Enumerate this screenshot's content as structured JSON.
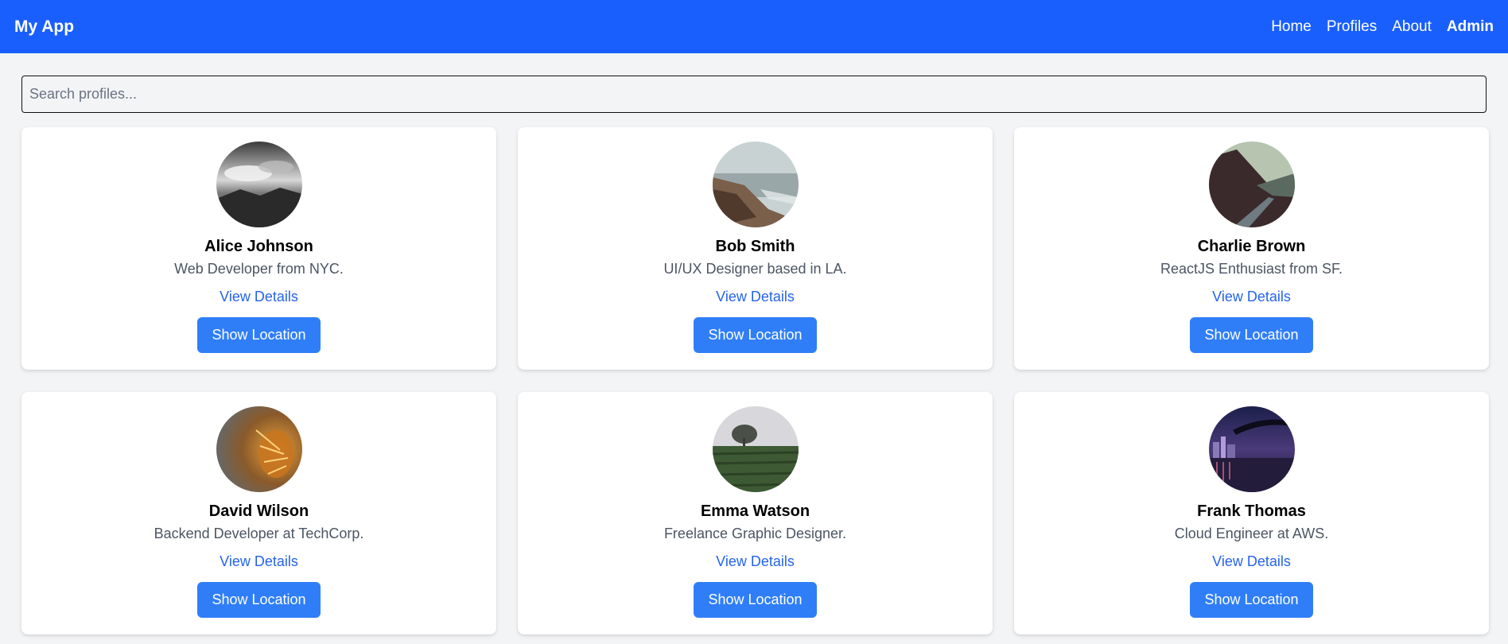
{
  "nav": {
    "brand": "My App",
    "links": [
      "Home",
      "Profiles",
      "About"
    ],
    "admin": "Admin"
  },
  "search": {
    "placeholder": "Search profiles...",
    "value": ""
  },
  "colors": {
    "navbar": "#195ffe",
    "button": "#2f7ef8",
    "link": "#2563eb"
  },
  "profiles": [
    {
      "name": "Alice Johnson",
      "bio": "Web Developer from NYC.",
      "link": "View Details",
      "button": "Show Location",
      "avatar": "clouds-mountain-bw-photo"
    },
    {
      "name": "Bob Smith",
      "bio": "UI/UX Designer based in LA.",
      "link": "View Details",
      "button": "Show Location",
      "avatar": "coastal-cliff-photo"
    },
    {
      "name": "Charlie Brown",
      "bio": "ReactJS Enthusiast from SF.",
      "link": "View Details",
      "button": "Show Location",
      "avatar": "mountain-road-photo"
    },
    {
      "name": "David Wilson",
      "bio": "Backend Developer at TechCorp.",
      "link": "View Details",
      "button": "Show Location",
      "avatar": "golden-plant-macro-photo"
    },
    {
      "name": "Emma Watson",
      "bio": "Freelance Graphic Designer.",
      "link": "View Details",
      "button": "Show Location",
      "avatar": "foggy-field-tree-photo"
    },
    {
      "name": "Frank Thomas",
      "bio": "Cloud Engineer at AWS.",
      "link": "View Details",
      "button": "Show Location",
      "avatar": "city-bridge-night-photo"
    }
  ]
}
